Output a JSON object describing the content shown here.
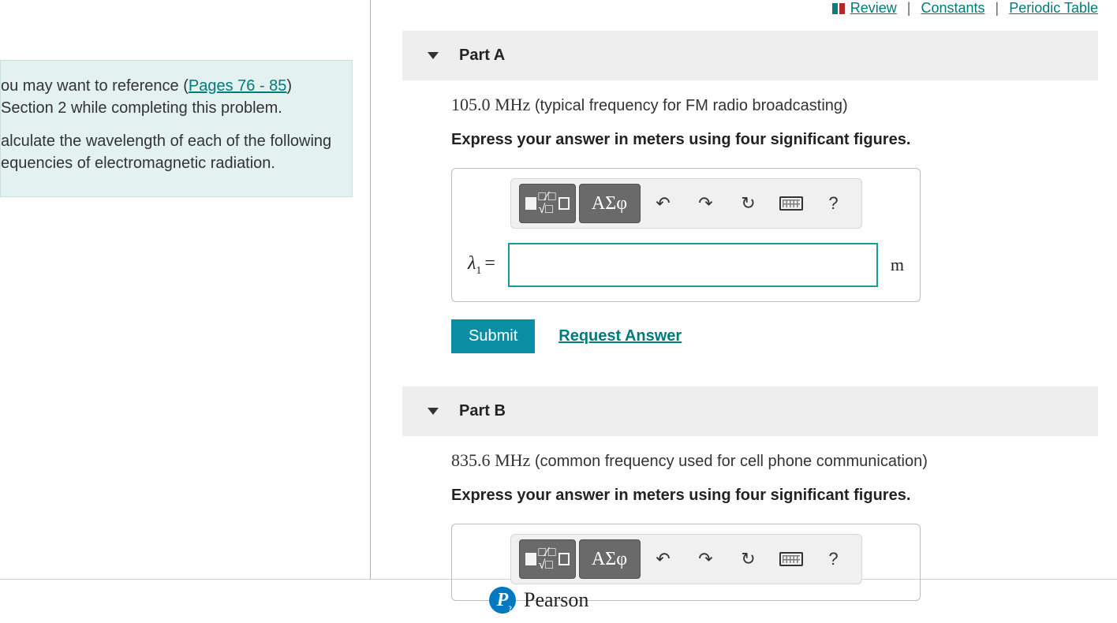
{
  "topLinks": {
    "review": "Review",
    "constants": "Constants",
    "periodic": "Periodic Table"
  },
  "infoBox": {
    "line1a": "ou may want to reference (",
    "pagesLink": "Pages 76 - 85",
    "line1b": ") Section 2 while completing this problem.",
    "line2": "alculate the wavelength of each of the following equencies of electromagnetic radiation."
  },
  "partA": {
    "title": "Part A",
    "freqVal": "105.0",
    "mhz": "MHz",
    "freqDesc": " (typical frequency for FM radio broadcasting)",
    "instr": "Express your answer in meters using four significant figures.",
    "greek": "ΑΣφ",
    "help": "?",
    "lambda": "λ",
    "sub": "1",
    "eq": "=",
    "unit": "m",
    "submit": "Submit",
    "request": "Request Answer",
    "input": ""
  },
  "partB": {
    "title": "Part B",
    "freqVal": "835.6",
    "mhz": "MHz",
    "freqDesc": " (common frequency used for cell phone communication)",
    "instr": "Express your answer in meters using four significant figures.",
    "greek": "ΑΣφ",
    "help": "?"
  },
  "footer": {
    "p": "P",
    "brand": "Pearson"
  }
}
